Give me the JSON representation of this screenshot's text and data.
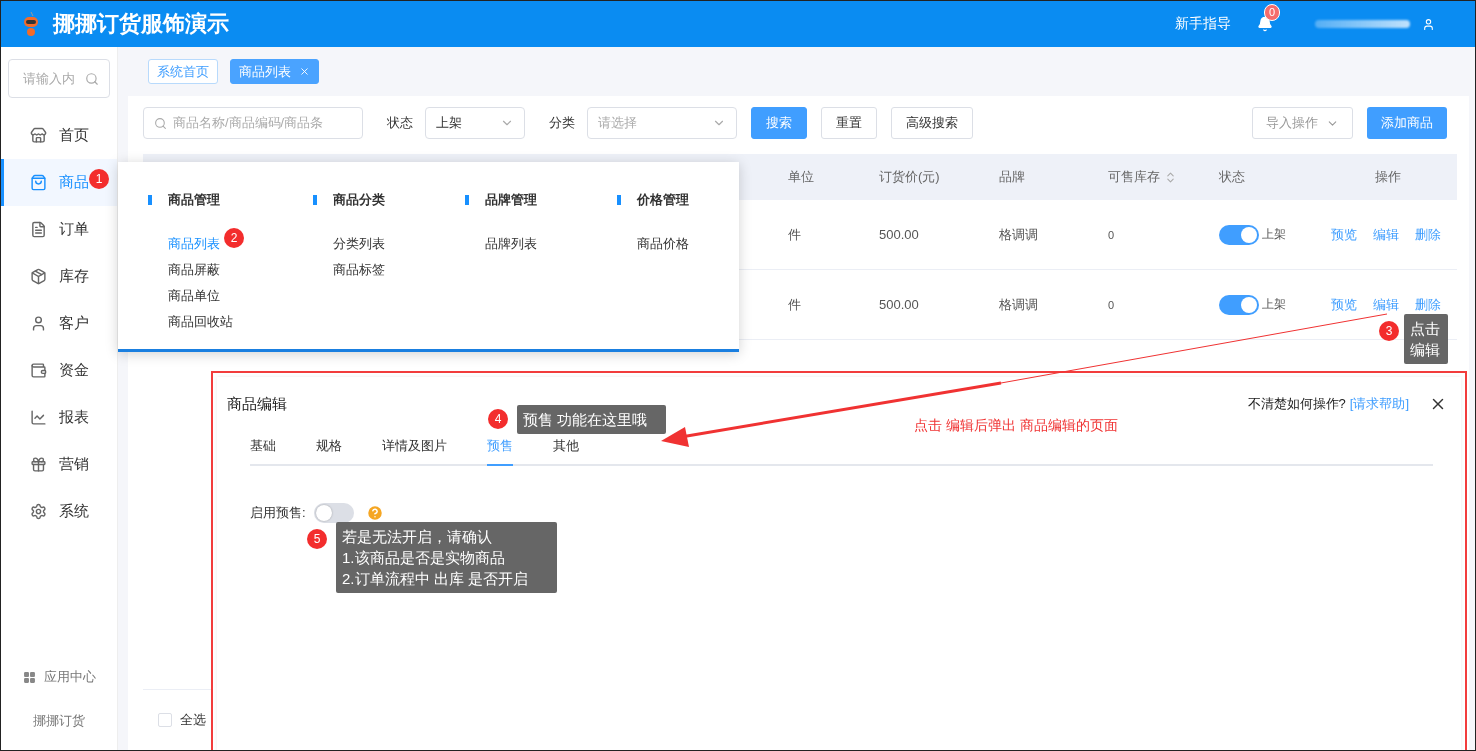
{
  "header": {
    "title": "挪挪订货服饰演示",
    "guide": "新手指导",
    "notifications": "0"
  },
  "sidebar": {
    "search_placeholder": "请输入内",
    "items": [
      {
        "label": "首页",
        "selected": false
      },
      {
        "label": "商品",
        "selected": true
      },
      {
        "label": "订单",
        "selected": false
      },
      {
        "label": "库存",
        "selected": false
      },
      {
        "label": "客户",
        "selected": false
      },
      {
        "label": "资金",
        "selected": false
      },
      {
        "label": "报表",
        "selected": false
      },
      {
        "label": "营销",
        "selected": false
      },
      {
        "label": "系统",
        "selected": false
      }
    ],
    "app_center": "应用中心",
    "footer": "挪挪订货"
  },
  "tabs": [
    {
      "label": "系统首页",
      "selected": false,
      "closable": false
    },
    {
      "label": "商品列表",
      "selected": true,
      "closable": true
    }
  ],
  "filters": {
    "search_placeholder": "商品名称/商品编码/商品条",
    "status_label": "状态",
    "status_value": "上架",
    "category_label": "分类",
    "category_placeholder": "请选择"
  },
  "buttons": [
    {
      "label": "搜索",
      "kind": "primary"
    },
    {
      "label": "重置",
      "kind": "default"
    },
    {
      "label": "高级搜索",
      "kind": "default"
    }
  ],
  "import_button": "导入操作",
  "add_button": "添加商品",
  "table": {
    "columns": [
      {
        "label": "单位",
        "sortable": false
      },
      {
        "label": "订货价(元)",
        "sortable": false
      },
      {
        "label": "品牌",
        "sortable": false
      },
      {
        "label": "可售库存",
        "sortable": true
      },
      {
        "label": "状态",
        "sortable": false
      },
      {
        "label": "操作",
        "sortable": false
      }
    ],
    "rows": [
      {
        "unit": "件",
        "price": "500.00",
        "brand": "格调调",
        "stock": "0",
        "on": true,
        "status": "上架",
        "actions": [
          "预览",
          "编辑",
          "删除"
        ]
      },
      {
        "unit": "件",
        "price": "500.00",
        "brand": "格调调",
        "stock": "0",
        "on": true,
        "status": "上架",
        "actions": [
          "预览",
          "编辑",
          "删除"
        ]
      }
    ]
  },
  "footer": {
    "select_all": "全选",
    "checked": false
  },
  "menu": {
    "groups": [
      {
        "title": "商品管理",
        "items": [
          {
            "label": "商品列表",
            "selected": true
          },
          {
            "label": "商品屏蔽",
            "selected": false
          },
          {
            "label": "商品单位",
            "selected": false
          },
          {
            "label": "商品回收站",
            "selected": false
          }
        ]
      },
      {
        "title": "商品分类",
        "items": [
          {
            "label": "分类列表",
            "selected": false
          },
          {
            "label": "商品标签",
            "selected": false
          }
        ]
      },
      {
        "title": "品牌管理",
        "items": [
          {
            "label": "品牌列表",
            "selected": false
          }
        ]
      },
      {
        "title": "价格管理",
        "items": [
          {
            "label": "商品价格",
            "selected": false
          }
        ]
      }
    ]
  },
  "modal": {
    "title": "商品编辑",
    "help_prompt": "不清楚如何操作?",
    "help_link": "[请求帮助]",
    "tabs": [
      {
        "label": "基础",
        "selected": false
      },
      {
        "label": "规格",
        "selected": false
      },
      {
        "label": "详情及图片",
        "selected": false
      },
      {
        "label": "预售",
        "selected": true
      },
      {
        "label": "其他",
        "selected": false
      }
    ],
    "presale_label": "启用预售:",
    "presale_on": false
  },
  "annotations": [
    {
      "number": "1"
    },
    {
      "number": "2"
    },
    {
      "number": "3",
      "note": "点击编辑"
    },
    {
      "number": "4",
      "note": "预售 功能在这里哦"
    },
    {
      "number": "5",
      "note": "若是无法开启，请确认\n1.该商品是否是实物商品\n2.订单流程中 出库  是否开启"
    }
  ],
  "caption": "点击 编辑后弹出 商品编辑的页面"
}
